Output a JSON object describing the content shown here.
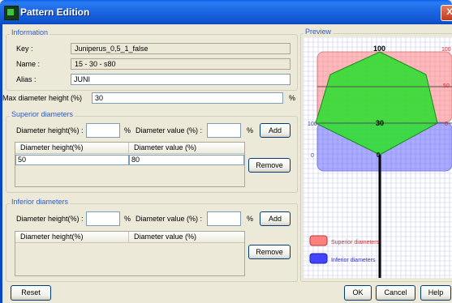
{
  "window": {
    "title": "Pattern Edition",
    "close_glyph": "X"
  },
  "information": {
    "legend": "Information",
    "key_label": "Key :",
    "key_value": "Juniperus_0,5_1_false",
    "name_label": "Name :",
    "name_value": "15 - 30 - s80",
    "alias_label": "Alias :",
    "alias_value": "JUNI"
  },
  "max_diameter": {
    "label": "Max diameter height (%)",
    "value": "30",
    "unit": "%"
  },
  "superior": {
    "legend": "Superior diameters",
    "height_label": "Diameter height(%) :",
    "height_value": "",
    "height_unit": "%",
    "value_label": "Diameter value (%) :",
    "value_value": "",
    "value_unit": "%",
    "add_label": "Add",
    "col_height": "Diameter height(%)",
    "col_value": "Diameter value (%)",
    "rows": [
      {
        "height": "50",
        "value": "80"
      }
    ],
    "remove_label": "Remove"
  },
  "inferior": {
    "legend": "Inferior diameters",
    "height_label": "Diameter height(%) :",
    "height_value": "",
    "height_unit": "%",
    "value_label": "Diameter value (%) :",
    "value_value": "",
    "value_unit": "%",
    "add_label": "Add",
    "col_height": "Diameter height(%)",
    "col_value": "Diameter value (%)",
    "rows": [],
    "remove_label": "Remove"
  },
  "preview": {
    "legend": "Preview",
    "label_top": "100",
    "label_top_right": "100",
    "label_mid_right": "50",
    "label_left": "100",
    "label_center": "30",
    "label_right": "0",
    "label_bottom_left": "0",
    "label_bottom_center": "0",
    "legend_superior": "Superior diameters",
    "legend_inferior": "Inferior diameters",
    "superior_color": "#ff7f7f",
    "inferior_color": "#4444ff",
    "crown_color": "#33dd33"
  },
  "footer": {
    "reset_label": "Reset",
    "ok_label": "OK",
    "cancel_label": "Cancel",
    "help_label": "Help"
  }
}
